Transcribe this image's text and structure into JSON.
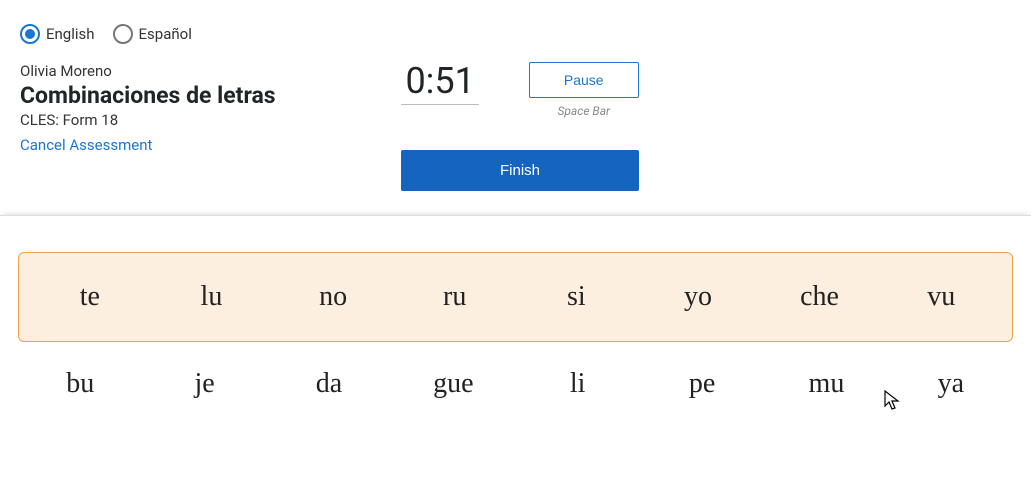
{
  "lang": {
    "english": "English",
    "espanol": "Español"
  },
  "header": {
    "student": "Olivia Moreno",
    "title": "Combinaciones de letras",
    "form": "CLES: Form 18",
    "cancel": "Cancel Assessment"
  },
  "controls": {
    "timer": "0:51",
    "pause": "Pause",
    "spacebar": "Space Bar",
    "finish": "Finish"
  },
  "rows": {
    "r1": {
      "c0": "te",
      "c1": "lu",
      "c2": "no",
      "c3": "ru",
      "c4": "si",
      "c5": "yo",
      "c6": "che",
      "c7": "vu"
    },
    "r2": {
      "c0": "bu",
      "c1": "je",
      "c2": "da",
      "c3": "gue",
      "c4": "li",
      "c5": "pe",
      "c6": "mu",
      "c7": "ya"
    }
  }
}
